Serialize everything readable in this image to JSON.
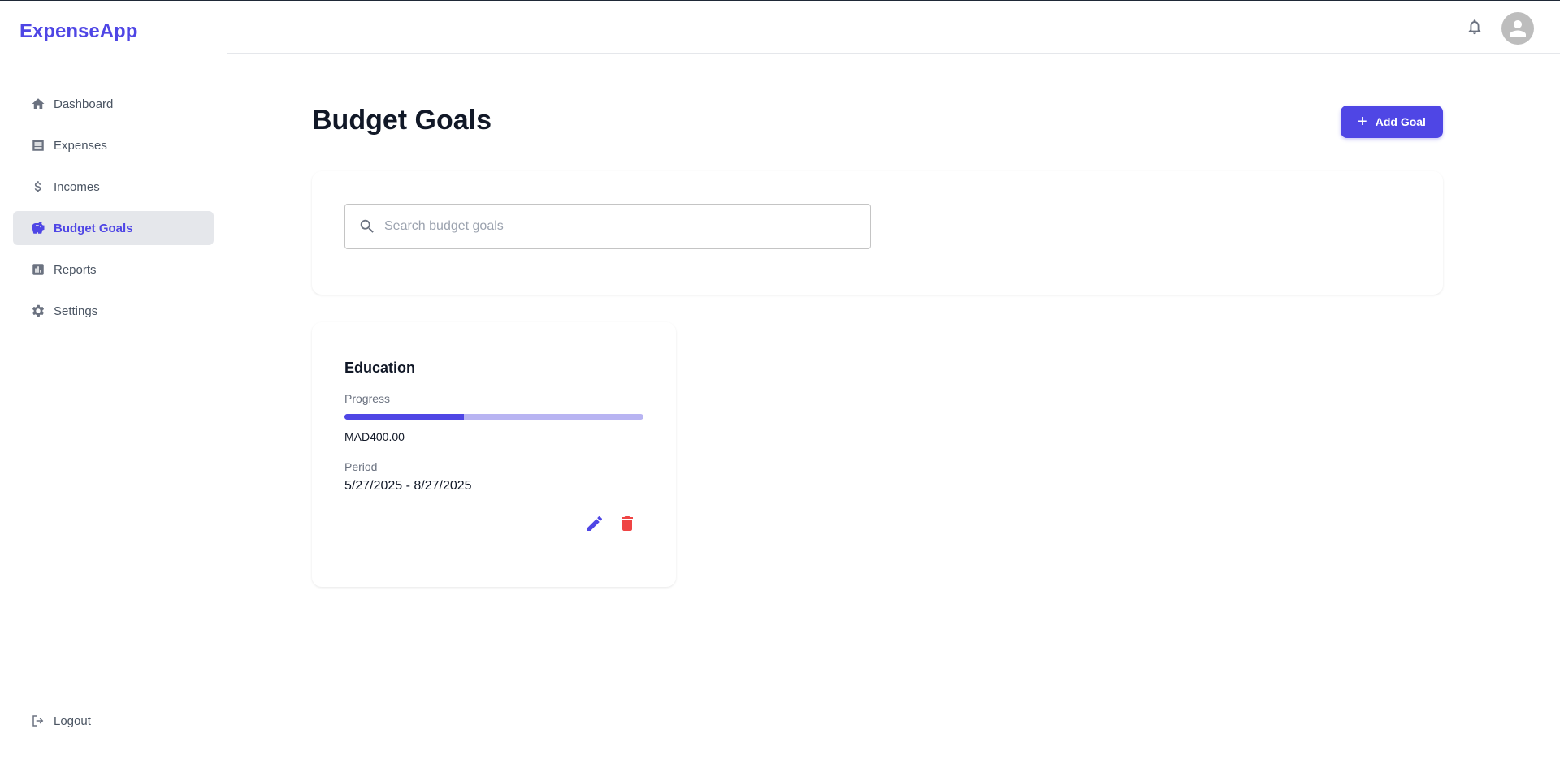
{
  "app": {
    "brand": "ExpenseApp"
  },
  "colors": {
    "accent": "#4f46e5",
    "danger": "#ef4444",
    "progress_track": "#b8b4f2"
  },
  "sidebar": {
    "items": [
      {
        "label": "Dashboard",
        "icon": "home-icon"
      },
      {
        "label": "Expenses",
        "icon": "list-icon"
      },
      {
        "label": "Incomes",
        "icon": "dollar-icon"
      },
      {
        "label": "Budget Goals",
        "icon": "piggy-bank-icon",
        "active": true
      },
      {
        "label": "Reports",
        "icon": "bar-chart-icon"
      },
      {
        "label": "Settings",
        "icon": "gear-icon"
      }
    ],
    "logout_label": "Logout"
  },
  "header": {
    "notification_icon": "bell-icon",
    "avatar_icon": "account-circle-icon"
  },
  "main": {
    "title": "Budget Goals",
    "add_button_label": "Add Goal",
    "search": {
      "placeholder": "Search budget goals",
      "value": ""
    },
    "goals": [
      {
        "name": "Education",
        "progress_label": "Progress",
        "progress_fraction": 0.4,
        "amount": "MAD400.00",
        "period_label": "Period",
        "period": "5/27/2025 - 8/27/2025"
      }
    ]
  }
}
